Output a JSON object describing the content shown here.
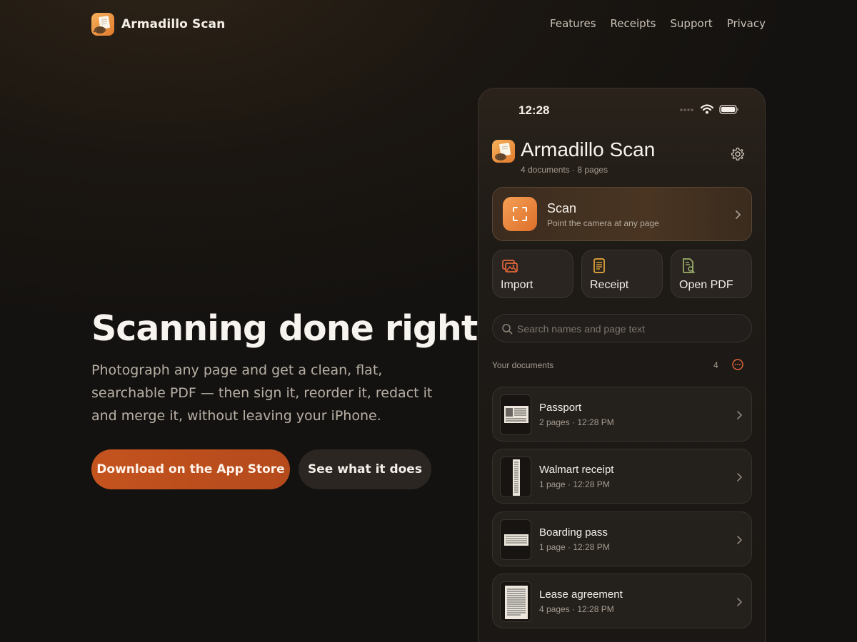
{
  "site": {
    "brand_name": "Armadillo Scan",
    "nav": [
      "Features",
      "Receipts",
      "Support",
      "Privacy"
    ]
  },
  "hero": {
    "title": "Scanning done right.",
    "subtitle": "Photograph any page and get a clean, flat, searchable PDF — then sign it, reorder it, redact it and merge it, without leaving your iPhone.",
    "primary_cta": "Download on the App Store",
    "secondary_cta": "See what it does"
  },
  "phone": {
    "status_time": "12:28",
    "app_title": "Armadillo Scan",
    "meta": "4 documents · 8 pages",
    "scan": {
      "title": "Scan",
      "subtitle": "Point the camera at any page"
    },
    "quick_actions": [
      {
        "label": "Import",
        "icon": "import-photos-icon"
      },
      {
        "label": "Receipt",
        "icon": "receipt-icon"
      },
      {
        "label": "Open PDF",
        "icon": "open-pdf-icon"
      }
    ],
    "search_placeholder": "Search names and page text",
    "documents_header": "Your documents",
    "documents_count": "4",
    "documents": [
      {
        "name": "Passport",
        "meta": "2 pages · 12:28 PM"
      },
      {
        "name": "Walmart receipt",
        "meta": "1 page · 12:28 PM"
      },
      {
        "name": "Boarding pass",
        "meta": "1 page · 12:28 PM"
      },
      {
        "name": "Lease agreement",
        "meta": "4 pages · 12:28 PM"
      }
    ]
  },
  "colors": {
    "accent": "#c4531e",
    "scan_button": "#e8873d",
    "background": "#171411"
  }
}
